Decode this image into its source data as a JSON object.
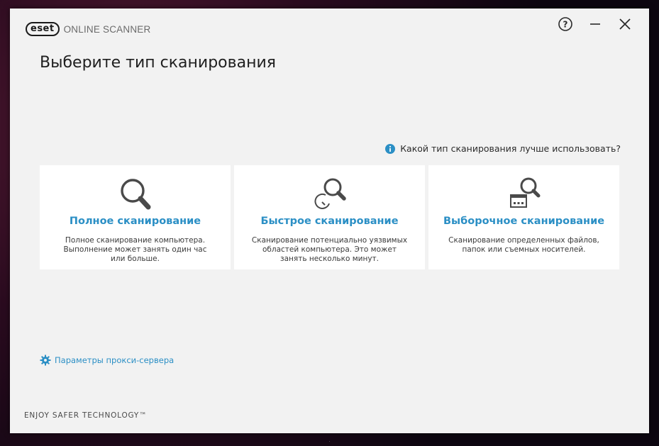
{
  "app": {
    "logo_badge": "eset",
    "logo_text": "ONLINE SCANNER"
  },
  "window_controls": {
    "help": "?",
    "minimize": "minimize",
    "close": "close"
  },
  "page": {
    "title": "Выберите тип сканирования",
    "help_link": "Какой тип сканирования лучше использовать?"
  },
  "cards": [
    {
      "title": "Полное сканирование",
      "description": "Полное сканирование компьютера. Выполнение может занять один час или больше.",
      "icon": "magnifier-icon"
    },
    {
      "title": "Быстрое сканирование",
      "description": "Сканирование потенциально уязвимых областей компьютера. Это может занять несколько минут.",
      "icon": "quick-scan-icon"
    },
    {
      "title": "Выборочное сканирование",
      "description": "Сканирование определенных файлов, папок или съемных носителей.",
      "icon": "custom-scan-icon"
    }
  ],
  "proxy": {
    "label": "Параметры прокси-сервера",
    "icon": "gear-icon"
  },
  "footer": {
    "tagline": "ENJOY SAFER TECHNOLOGY™"
  },
  "colors": {
    "accent": "#2b8fc5",
    "window_bg": "#f2f2f2",
    "card_bg": "#ffffff",
    "icon_gray": "#4a4a4a"
  }
}
